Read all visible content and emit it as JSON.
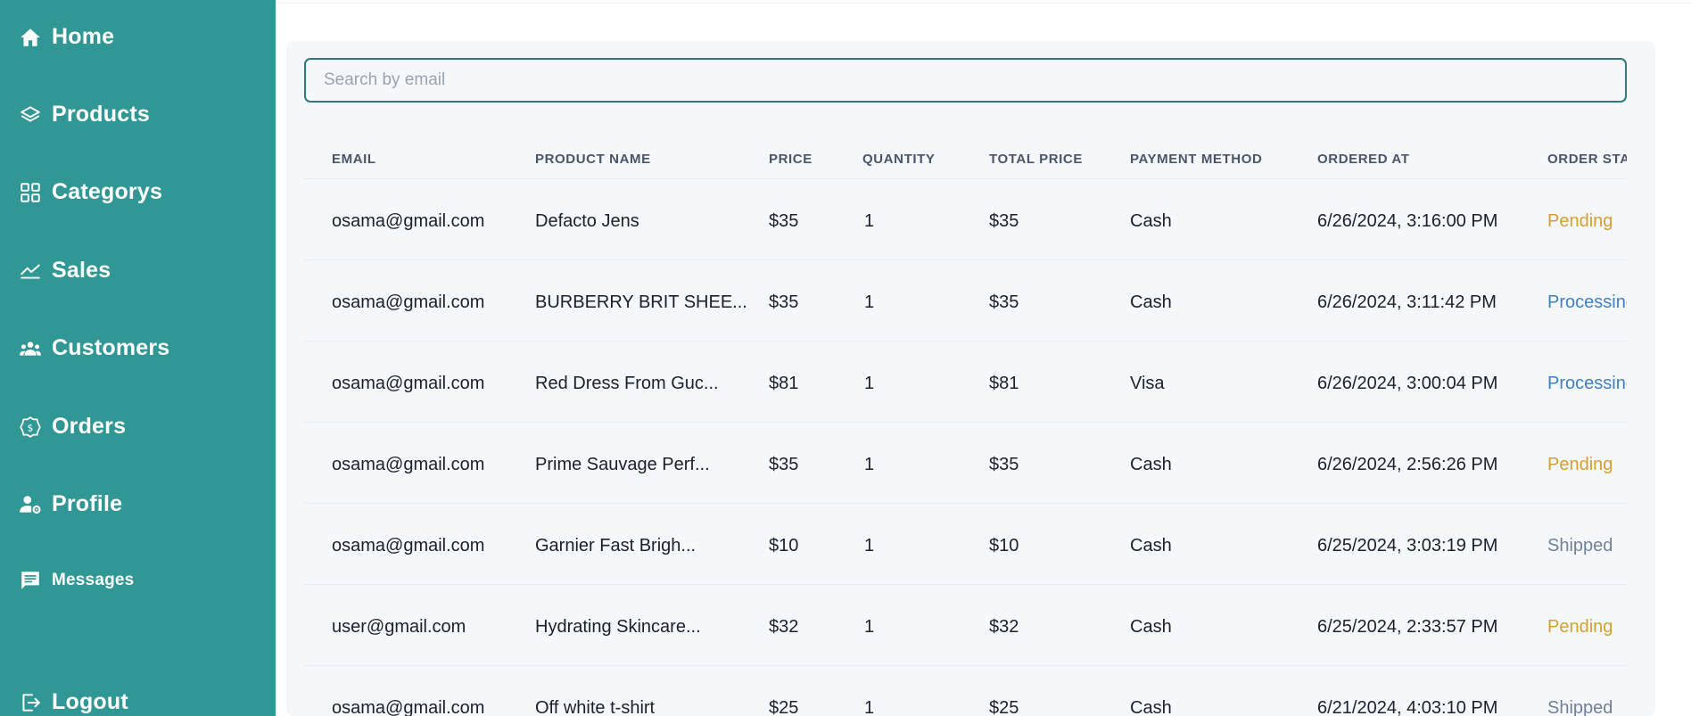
{
  "sidebar": {
    "items": [
      {
        "label": "Home"
      },
      {
        "label": "Products"
      },
      {
        "label": "Categorys"
      },
      {
        "label": "Sales"
      },
      {
        "label": "Customers"
      },
      {
        "label": "Orders"
      },
      {
        "label": "Profile"
      },
      {
        "label": "Messages"
      },
      {
        "label": "Logout"
      }
    ]
  },
  "search": {
    "placeholder": "Search by email",
    "value": ""
  },
  "table": {
    "headers": [
      "EMAIL",
      "PRODUCT NAME",
      "PRICE",
      "QUANTITY",
      "TOTAL PRICE",
      "PAYMENT METHOD",
      "ORDERED AT",
      "ORDER STATUS"
    ],
    "rows": [
      {
        "email": "osama@gmail.com",
        "product": "Defacto Jens",
        "price": "$35",
        "qty": "1",
        "total": "$35",
        "payment": "Cash",
        "ordered": "6/26/2024, 3:16:00 PM",
        "status": "Pending"
      },
      {
        "email": "osama@gmail.com",
        "product": "BURBERRY BRIT SHEE...",
        "price": "$35",
        "qty": "1",
        "total": "$35",
        "payment": "Cash",
        "ordered": "6/26/2024, 3:11:42 PM",
        "status": "Processing"
      },
      {
        "email": "osama@gmail.com",
        "product": "Red Dress From Guc...",
        "price": "$81",
        "qty": "1",
        "total": "$81",
        "payment": "Visa",
        "ordered": "6/26/2024, 3:00:04 PM",
        "status": "Processing"
      },
      {
        "email": "osama@gmail.com",
        "product": "Prime Sauvage Perf...",
        "price": "$35",
        "qty": "1",
        "total": "$35",
        "payment": "Cash",
        "ordered": "6/26/2024, 2:56:26 PM",
        "status": "Pending"
      },
      {
        "email": "osama@gmail.com",
        "product": "Garnier Fast Brigh...",
        "price": "$10",
        "qty": "1",
        "total": "$10",
        "payment": "Cash",
        "ordered": "6/25/2024, 3:03:19 PM",
        "status": "Shipped"
      },
      {
        "email": "user@gmail.com",
        "product": "Hydrating Skincare...",
        "price": "$32",
        "qty": "1",
        "total": "$32",
        "payment": "Cash",
        "ordered": "6/25/2024, 2:33:57 PM",
        "status": "Pending"
      },
      {
        "email": "osama@gmail.com",
        "product": "Off white t-shirt",
        "price": "$25",
        "qty": "1",
        "total": "$25",
        "payment": "Cash",
        "ordered": "6/21/2024, 4:03:10 PM",
        "status": "Shipped"
      }
    ]
  },
  "colors": {
    "sidebar_bg": "#319795",
    "accent": "#2c7a7b",
    "pending": "#d69e2e",
    "processing": "#3f7fc4",
    "shipped": "#718096"
  }
}
